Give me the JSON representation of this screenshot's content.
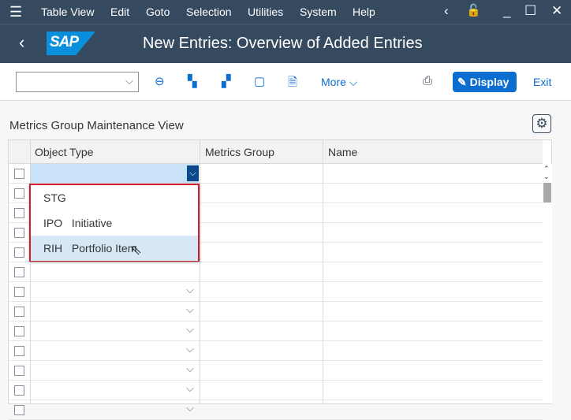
{
  "menu": {
    "items": [
      "Table View",
      "Edit",
      "Goto",
      "Selection",
      "Utilities",
      "System",
      "Help"
    ]
  },
  "header": {
    "title": "New Entries: Overview of Added Entries",
    "logo": "SAP"
  },
  "toolbar": {
    "more_label": "More",
    "display_label": "Display",
    "exit_label": "Exit",
    "command_field": ""
  },
  "section": {
    "title": "Metrics Group Maintenance View"
  },
  "table": {
    "columns": [
      "Object Type",
      "Metrics Group",
      "Name"
    ],
    "row_count": 12
  },
  "dropdown": {
    "options": [
      {
        "code": "STG",
        "text": ""
      },
      {
        "code": "IPO",
        "text": "Initiative"
      },
      {
        "code": "RIH",
        "text": "Portfolio Item"
      }
    ],
    "hovered": "RIH"
  }
}
